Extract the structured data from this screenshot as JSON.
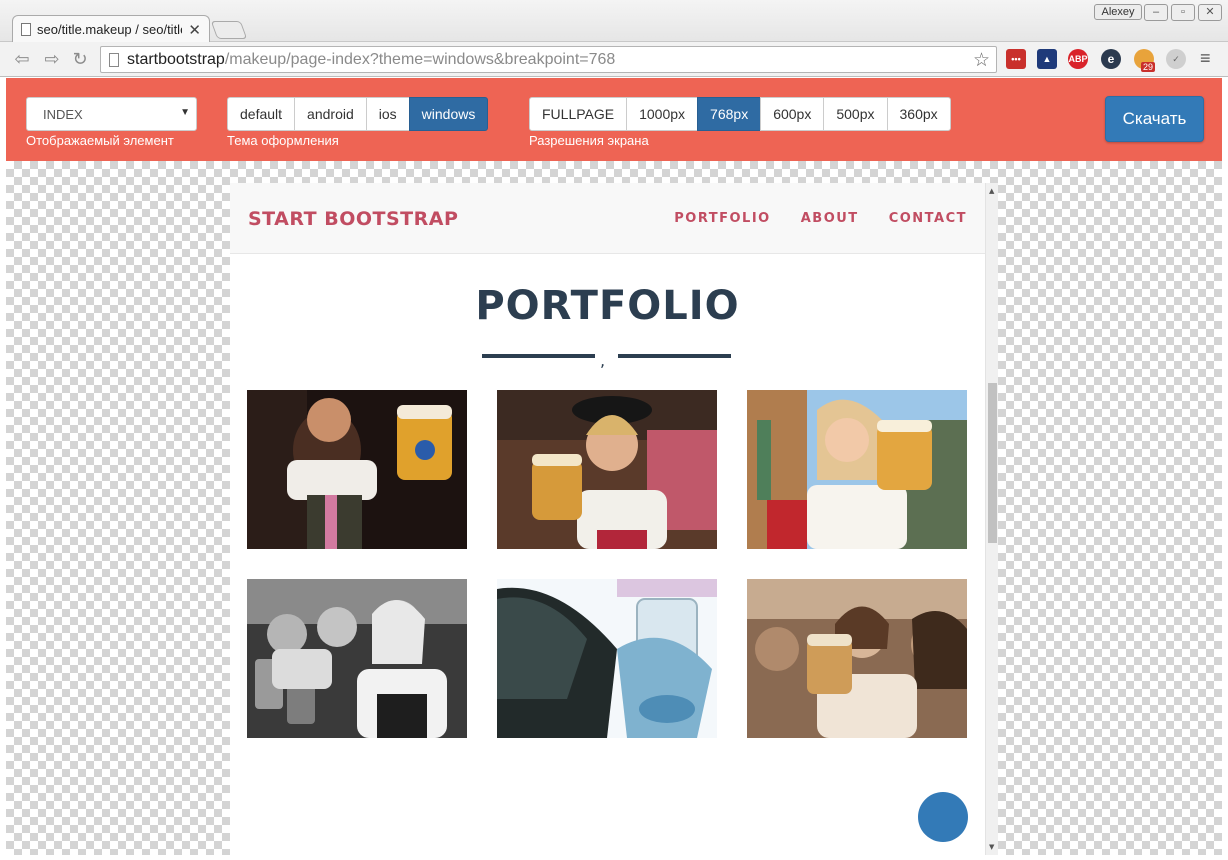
{
  "browser": {
    "tab_title": "seo/title.makeup / seo/title",
    "profile_name": "Alexey",
    "url_host": "startbootstrap",
    "url_path": "/makeup/page-index?theme=windows&breakpoint=768",
    "extension_badge": "29",
    "abp_label": "ABP"
  },
  "controls": {
    "element_select": {
      "value": "INDEX",
      "label": "Отображаемый элемент"
    },
    "theme": {
      "label": "Тема оформления",
      "options": [
        "default",
        "android",
        "ios",
        "windows"
      ],
      "selected": "windows"
    },
    "resolution": {
      "label": "Разрешения экрана",
      "options": [
        "FULLPAGE",
        "1000px",
        "768px",
        "600px",
        "500px",
        "360px"
      ],
      "selected": "768px"
    },
    "download_label": "Скачать"
  },
  "site": {
    "brand": "START BOOTSTRAP",
    "nav": [
      "PORTFOLIO",
      "ABOUT",
      "CONTACT"
    ],
    "section_title": "PORTFOLIO",
    "divider_mark": ","
  },
  "portfolio_tiles": [
    {
      "tone": "dark-warm"
    },
    {
      "tone": "warm-crowd"
    },
    {
      "tone": "sunlit-outdoor"
    },
    {
      "tone": "grayscale"
    },
    {
      "tone": "inverted-cyan"
    },
    {
      "tone": "sepia"
    }
  ],
  "colors": {
    "panel": "#ee6454",
    "active_button": "#2f6ba3",
    "download_button": "#337ab7",
    "brand_text": "#c14d62",
    "heading": "#2c3e50"
  }
}
